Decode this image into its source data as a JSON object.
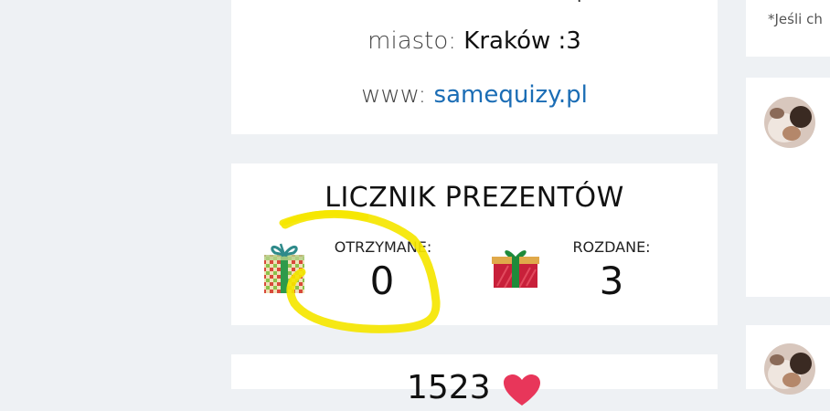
{
  "profile": {
    "city_label": "miasto:",
    "city_value": "Kraków :3",
    "www_label": "www:",
    "www_value": "samequizy.pl"
  },
  "gifts": {
    "title": "LICZNIK PREZENTÓW",
    "received_label": "OTRZYMANE:",
    "received_value": "0",
    "given_label": "ROZDANE:",
    "given_value": "3",
    "received_icon": "gift-checkered-icon",
    "given_icon": "gift-red-icon"
  },
  "likes": {
    "count": "1523",
    "icon": "heart-icon"
  },
  "side": {
    "note": "*Jeśli ch"
  },
  "colors": {
    "page_bg": "#eef1f4",
    "link": "#1b6db5",
    "highlight": "#f5e600",
    "heart": "#e8365a"
  }
}
